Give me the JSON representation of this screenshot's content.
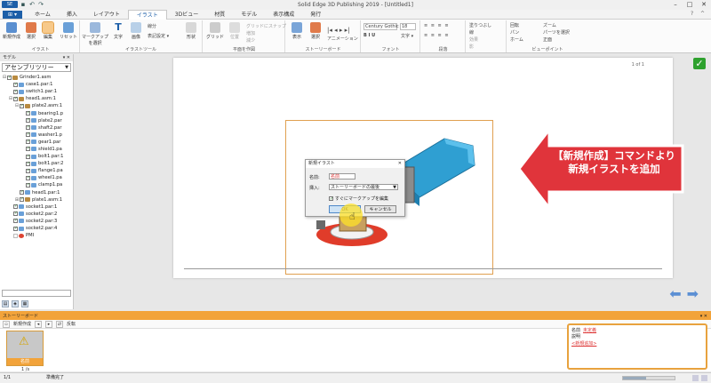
{
  "window": {
    "title": "Solid Edge 3D Publishing 2019 - [Untitled1]",
    "min": "–",
    "max": "□",
    "close": "✕"
  },
  "menu": {
    "file_label": "⊞ ▾",
    "tabs": [
      {
        "label": "ホーム",
        "active": false
      },
      {
        "label": "挿入",
        "active": false
      },
      {
        "label": "レイアウト",
        "active": false
      },
      {
        "label": "イラスト",
        "active": true
      },
      {
        "label": "3Dビュー",
        "active": false
      },
      {
        "label": "材質",
        "active": false
      },
      {
        "label": "モデル",
        "active": false
      },
      {
        "label": "表示構成",
        "active": false
      },
      {
        "label": "発行",
        "active": false
      }
    ]
  },
  "ribbon": {
    "groups": {
      "illust": {
        "label": "イラスト",
        "buttons": [
          {
            "label": "新規作成",
            "icon": "new-illustration-icon"
          },
          {
            "label": "選択",
            "icon": "select-icon"
          },
          {
            "label": "編集",
            "icon": "edit-icon",
            "selected": true
          },
          {
            "label": "リセット",
            "icon": "reset-icon"
          }
        ]
      },
      "tools": {
        "label": "イラストツール",
        "buttons": [
          {
            "label": "マークアップを選択",
            "icon": "markup-icon"
          },
          {
            "label": "文字",
            "icon": "text-icon"
          },
          {
            "label": "画像",
            "icon": "image-icon"
          },
          {
            "label": "形状",
            "icon": "shape-icon"
          }
        ],
        "small": [
          "線分",
          "表記設定 ▾"
        ]
      },
      "plane": {
        "label": "平面を作図",
        "buttons": [
          {
            "label": "グリッド",
            "icon": "grid-icon"
          },
          {
            "label": "位置",
            "icon": "position-icon"
          }
        ],
        "small": [
          "グリッドにスナップ",
          "増加",
          "減少"
        ]
      },
      "story": {
        "label": "ストーリーボード",
        "buttons": [
          {
            "label": "表示",
            "icon": "display-icon"
          },
          {
            "label": "選択",
            "icon": "select-icon"
          }
        ],
        "small": [
          "アニメーション"
        ]
      },
      "font": {
        "label": "フォント",
        "font_name": "Century Gothic",
        "font_size": "18",
        "small": [
          "文字 ▾"
        ]
      },
      "para": {
        "label": "段落"
      },
      "misc": {
        "label": "",
        "small": [
          "塗りつぶし",
          "線",
          "効果",
          "影"
        ]
      },
      "viewpoint": {
        "label": "ビューポイント",
        "small": [
          "回転",
          "パン",
          "ホーム",
          "ズーム",
          "パーツを選択",
          "正面"
        ]
      }
    }
  },
  "left_panel": {
    "title": "モデル",
    "combo": "アセンブリツリー",
    "tree": [
      {
        "label": "Grinder1.asm",
        "indent": 0,
        "exp": "⊟",
        "cb": "on",
        "icon": "gold"
      },
      {
        "label": "case1.par:1",
        "indent": 1,
        "exp": "",
        "cb": "on",
        "icon": "blue"
      },
      {
        "label": "switch1.par:1",
        "indent": 1,
        "exp": "",
        "cb": "on",
        "icon": "blue"
      },
      {
        "label": "head1.asm:1",
        "indent": 1,
        "exp": "⊟",
        "cb": "on",
        "icon": "gold"
      },
      {
        "label": "plate2.asm:1",
        "indent": 2,
        "exp": "⊟",
        "cb": "on",
        "icon": "gold"
      },
      {
        "label": "bearing1.p",
        "indent": 3,
        "exp": "",
        "cb": "on",
        "icon": "blue"
      },
      {
        "label": "plate2.par",
        "indent": 3,
        "exp": "",
        "cb": "on",
        "icon": "blue"
      },
      {
        "label": "shaft2.par",
        "indent": 3,
        "exp": "",
        "cb": "on",
        "icon": "blue"
      },
      {
        "label": "washer1.p",
        "indent": 3,
        "exp": "",
        "cb": "on",
        "icon": "blue"
      },
      {
        "label": "gear1.par",
        "indent": 3,
        "exp": "",
        "cb": "on",
        "icon": "blue"
      },
      {
        "label": "shield1.pa",
        "indent": 3,
        "exp": "",
        "cb": "on",
        "icon": "blue"
      },
      {
        "label": "bolt1.par:1",
        "indent": 3,
        "exp": "",
        "cb": "on",
        "icon": "blue"
      },
      {
        "label": "bolt1.par:2",
        "indent": 3,
        "exp": "",
        "cb": "on",
        "icon": "blue"
      },
      {
        "label": "flange1.pa",
        "indent": 3,
        "exp": "",
        "cb": "on",
        "icon": "blue"
      },
      {
        "label": "wheel1.pa",
        "indent": 3,
        "exp": "",
        "cb": "on",
        "icon": "blue"
      },
      {
        "label": "clamp1.pa",
        "indent": 3,
        "exp": "",
        "cb": "on",
        "icon": "blue"
      },
      {
        "label": "head1.par:1",
        "indent": 2,
        "exp": "",
        "cb": "on",
        "icon": "blue"
      },
      {
        "label": "plate1.asm:1",
        "indent": 2,
        "exp": "⊞",
        "cb": "on",
        "icon": "gold"
      },
      {
        "label": "socket1.par:1",
        "indent": 1,
        "exp": "",
        "cb": "on",
        "icon": "blue"
      },
      {
        "label": "socket2.par:2",
        "indent": 1,
        "exp": "",
        "cb": "on",
        "icon": "blue"
      },
      {
        "label": "socket2.par:3",
        "indent": 1,
        "exp": "",
        "cb": "on",
        "icon": "blue"
      },
      {
        "label": "socket2.par:4",
        "indent": 1,
        "exp": "",
        "cb": "on",
        "icon": "blue"
      },
      {
        "label": "PMI",
        "indent": 1,
        "exp": "",
        "cb": "off",
        "icon": "red"
      }
    ]
  },
  "canvas": {
    "page_number": "1 of 1"
  },
  "dialog": {
    "title": "新規イラスト",
    "name_label": "名前:",
    "name_value": "名前",
    "insert_label": "挿入:",
    "insert_value": "ストーリーボードの最後",
    "checkbox_label": "すぐにマークアップを編集",
    "checkbox_mark": "✓",
    "ok": "OK",
    "cancel": "キャンセル"
  },
  "callout": {
    "line1": "【新規作成】コマンドより",
    "line2": "新規イラストを追加",
    "color": "#e0343b"
  },
  "storyboard": {
    "title": "ストーリーボード",
    "new_label": "新規作成",
    "prev": "◂",
    "next": "▸",
    "invert_label": "反転",
    "thumb_label": "名前",
    "thumb_count": "1 /s",
    "warn_icon": "⚠"
  },
  "properties": {
    "name_label": "名前",
    "name_value": "未定義",
    "desc_label": "説明",
    "desc_value": "<新規追加>"
  },
  "status": {
    "page": "1/1",
    "text": "準備完了"
  },
  "colors": {
    "accent": "#1d5fa8",
    "storyboard": "#f2a33a",
    "callout": "#e0343b",
    "confirm": "#2ea12e"
  }
}
